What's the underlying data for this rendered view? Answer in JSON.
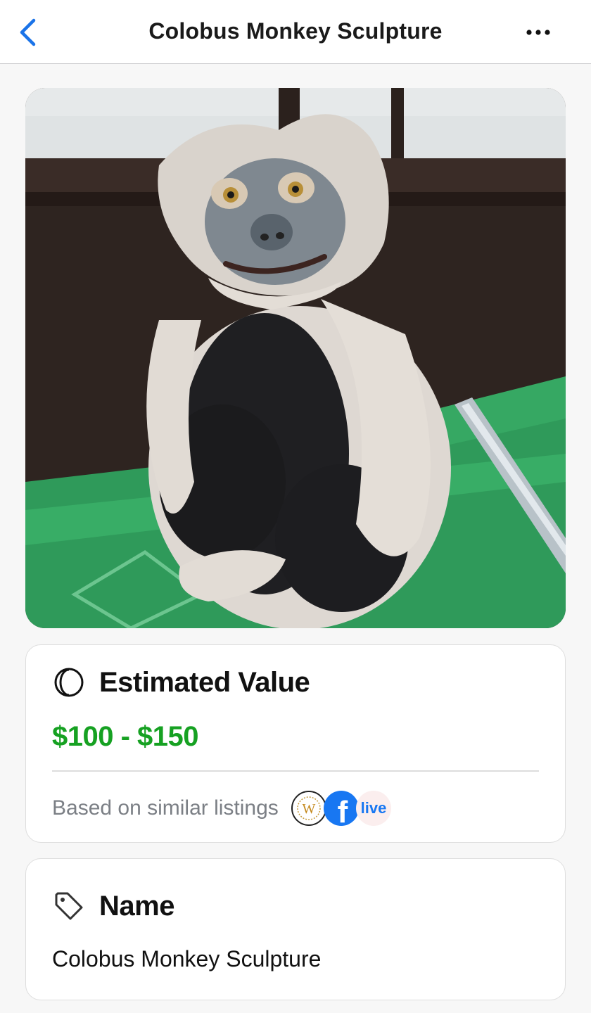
{
  "nav": {
    "title": "Colobus Monkey Sculpture",
    "back_icon": "chevron-left-icon",
    "more_icon": "ellipsis-icon",
    "accent_color": "#1a73e8"
  },
  "estimated_value": {
    "heading": "Estimated Value",
    "icon": "coin-icon",
    "range": "$100 - $150",
    "range_color": "#16a122",
    "source_text": "Based on similar listings",
    "sources": [
      {
        "name": "worthpoint-logo",
        "letter": "W"
      },
      {
        "name": "facebook-logo",
        "letter": "f"
      },
      {
        "name": "live-logo",
        "text": "live"
      }
    ]
  },
  "name_card": {
    "heading": "Name",
    "icon": "tag-icon",
    "value": "Colobus Monkey Sculpture"
  }
}
